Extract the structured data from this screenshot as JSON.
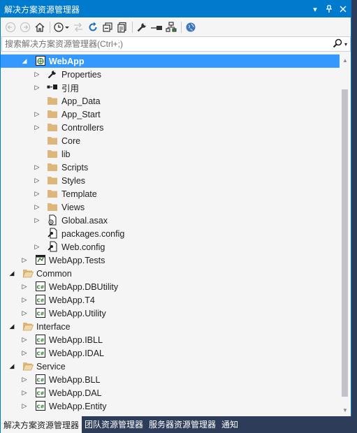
{
  "window": {
    "title": "解决方案资源管理器",
    "controls": [
      "dropdown-arrow",
      "pin",
      "close"
    ]
  },
  "toolbar": {
    "buttons": [
      "back-icon",
      "forward-icon",
      "home-icon",
      "history-icon",
      "sync-icon",
      "refresh-icon",
      "collapse-all-icon",
      "show-all-files-icon",
      "properties-icon",
      "preview-icon",
      "view-code-icon",
      "browser-icon"
    ]
  },
  "search": {
    "placeholder": "搜索解决方案资源管理器(Ctrl+;)"
  },
  "tree": {
    "webapp": "WebApp",
    "properties": "Properties",
    "references": "引用",
    "app_data": "App_Data",
    "app_start": "App_Start",
    "controllers": "Controllers",
    "core": "Core",
    "lib": "lib",
    "scripts": "Scripts",
    "styles": "Styles",
    "template": "Template",
    "views": "Views",
    "global_asax": "Global.asax",
    "packages_config": "packages.config",
    "web_config": "Web.config",
    "webapp_tests": "WebApp.Tests",
    "common": "Common",
    "dbutility": "WebApp.DBUtility",
    "t4": "WebApp.T4",
    "utility": "WebApp.Utility",
    "interface": "Interface",
    "ibll": "WebApp.IBLL",
    "idal": "WebApp.IDAL",
    "service": "Service",
    "bll": "WebApp.BLL",
    "dal": "WebApp.DAL",
    "entity": "WebApp.Entity"
  },
  "tabs": {
    "solution_explorer": "解决方案资源管理器",
    "team_explorer": "团队资源管理器",
    "server_explorer": "服务器资源管理器",
    "notifications": "通知"
  },
  "colors": {
    "accent": "#007acc",
    "selection": "#3399ff",
    "tab_bar": "#2d3c58",
    "folder": "#dcb67a"
  }
}
